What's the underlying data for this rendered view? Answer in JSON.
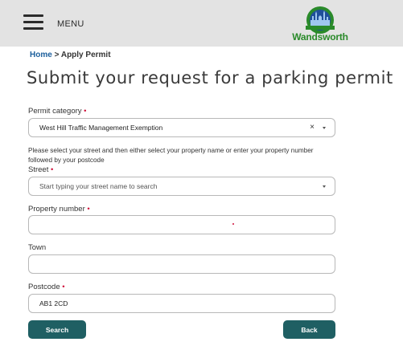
{
  "header": {
    "menu_label": "MENU",
    "logo_arc_text": "THE BRIGHTER BOROUGH",
    "logo_text": "Wandsworth",
    "logo_colors": {
      "green": "#2a8a2a",
      "blue": "#1f4f9a"
    }
  },
  "breadcrumb": {
    "home": "Home",
    "separator": ">",
    "current": "Apply Permit"
  },
  "page": {
    "title": "Submit your request for a parking permit"
  },
  "form": {
    "permit_category": {
      "label": "Permit category",
      "value": "West Hill Traffic Management Exemption",
      "clear_icon": "×"
    },
    "help_text": "Please select your street and then either select your property name or enter your property number followed by your postcode",
    "street": {
      "label": "Street",
      "placeholder": "Start typing your street name to search"
    },
    "property_number": {
      "label": "Property number",
      "value": ""
    },
    "town": {
      "label": "Town",
      "value": ""
    },
    "postcode": {
      "label": "Postcode",
      "value": "AB1 2CD"
    },
    "required_marker": "•"
  },
  "buttons": {
    "search": "Search",
    "back": "Back"
  },
  "colors": {
    "button": "#1f5f63",
    "link": "#1c5f9c",
    "required": "#d0103a",
    "header_bg": "#e3e3e3"
  }
}
